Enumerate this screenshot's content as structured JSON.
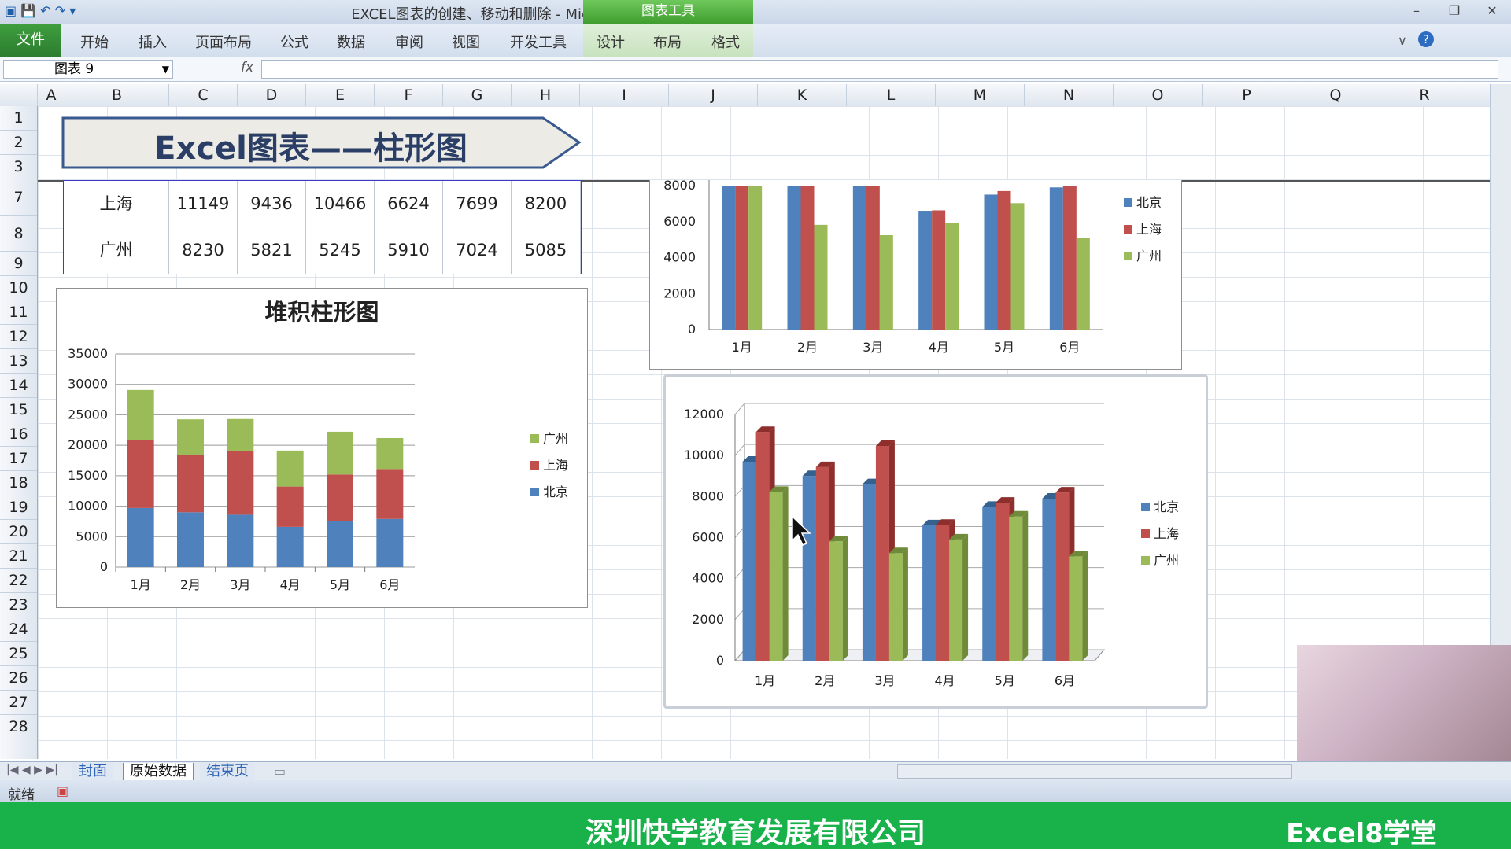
{
  "window": {
    "title": "EXCEL图表的创建、移动和删除 - Microsoft Excel",
    "chart_tools_label": "图表工具"
  },
  "ribbon": {
    "file_tab": "文件",
    "tabs": [
      "开始",
      "插入",
      "页面布局",
      "公式",
      "数据",
      "审阅",
      "视图",
      "开发工具",
      "设计",
      "布局",
      "格式"
    ]
  },
  "formula_bar": {
    "name_box": "图表 9",
    "fx": "fx",
    "content": ""
  },
  "columns": [
    "A",
    "B",
    "C",
    "D",
    "E",
    "F",
    "G",
    "H",
    "I",
    "J",
    "K",
    "L",
    "M",
    "N",
    "O",
    "P",
    "Q",
    "R"
  ],
  "rows": [
    "1",
    "2",
    "3",
    "7",
    "8",
    "9",
    "10",
    "11",
    "12",
    "13",
    "14",
    "15",
    "16",
    "17",
    "18",
    "19",
    "20",
    "21",
    "22",
    "23",
    "24",
    "25",
    "26",
    "27",
    "28"
  ],
  "banner": {
    "title": "Excel图表——柱形图"
  },
  "table": {
    "rows": [
      {
        "city": "上海",
        "values": [
          "11149",
          "9436",
          "10466",
          "6624",
          "7699",
          "8200"
        ]
      },
      {
        "city": "广州",
        "values": [
          "8230",
          "5821",
          "5245",
          "5910",
          "7024",
          "5085"
        ]
      }
    ]
  },
  "chart_data": [
    {
      "type": "bar",
      "stacked": true,
      "title": "堆积柱形图",
      "categories": [
        "1月",
        "2月",
        "3月",
        "4月",
        "5月",
        "6月"
      ],
      "series": [
        {
          "name": "北京",
          "color": "#4f81bd",
          "values": [
            9700,
            9000,
            8600,
            6600,
            7500,
            7900
          ]
        },
        {
          "name": "上海",
          "color": "#c0504d",
          "values": [
            11149,
            9436,
            10466,
            6624,
            7699,
            8200
          ]
        },
        {
          "name": "广州",
          "color": "#9bbb59",
          "values": [
            8230,
            5821,
            5245,
            5910,
            7024,
            5085
          ]
        }
      ],
      "legend_order": [
        "广州",
        "上海",
        "北京"
      ],
      "ylim": [
        0,
        35000
      ],
      "yticks": [
        0,
        5000,
        10000,
        15000,
        20000,
        25000,
        30000,
        35000
      ],
      "legend": "right",
      "grid": true
    },
    {
      "type": "bar",
      "title": "",
      "categories": [
        "1月",
        "2月",
        "3月",
        "4月",
        "5月",
        "6月"
      ],
      "series": [
        {
          "name": "北京",
          "color": "#4f81bd",
          "values": [
            9700,
            9000,
            8600,
            6600,
            7500,
            7900
          ]
        },
        {
          "name": "上海",
          "color": "#c0504d",
          "values": [
            11149,
            9436,
            10466,
            6624,
            7699,
            8200
          ]
        },
        {
          "name": "广州",
          "color": "#9bbb59",
          "values": [
            8230,
            5821,
            5245,
            5910,
            7024,
            5085
          ]
        }
      ],
      "ylim": [
        0,
        8000
      ],
      "yticks": [
        0,
        2000,
        4000,
        6000,
        8000
      ],
      "legend": "right",
      "grid": false,
      "note": "partially hidden by frozen pane"
    },
    {
      "type": "bar",
      "style": "3d",
      "title": "",
      "categories": [
        "1月",
        "2月",
        "3月",
        "4月",
        "5月",
        "6月"
      ],
      "series": [
        {
          "name": "北京",
          "color": "#4f81bd",
          "values": [
            9700,
            9000,
            8600,
            6600,
            7500,
            7900
          ]
        },
        {
          "name": "上海",
          "color": "#c0504d",
          "values": [
            11149,
            9436,
            10466,
            6624,
            7699,
            8200
          ]
        },
        {
          "name": "广州",
          "color": "#9bbb59",
          "values": [
            8230,
            5821,
            5245,
            5910,
            7024,
            5085
          ]
        }
      ],
      "ylim": [
        0,
        12000
      ],
      "yticks": [
        0,
        2000,
        4000,
        6000,
        8000,
        10000,
        12000
      ],
      "legend": "right",
      "grid": true
    }
  ],
  "sheet_tabs": [
    "封面",
    "原始数据",
    "结束页"
  ],
  "status": {
    "ready": "就绪"
  },
  "footer": {
    "company": "深圳快学教育发展有限公司",
    "brand": "Excel8学堂"
  }
}
